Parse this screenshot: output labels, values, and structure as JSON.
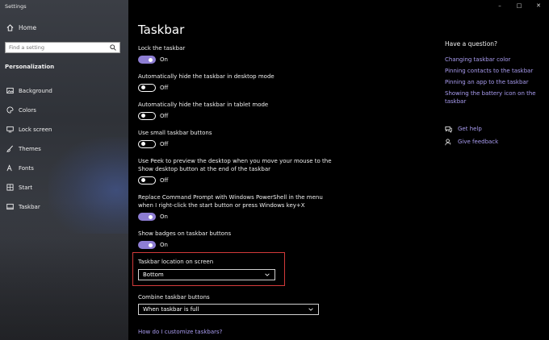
{
  "window": {
    "title": "Settings",
    "controls": [
      "–",
      "□",
      "✕"
    ]
  },
  "sidebar": {
    "home_label": "Home",
    "search_placeholder": "Find a setting",
    "section": "Personalization",
    "items": [
      {
        "label": "Background",
        "icon": "picture-icon"
      },
      {
        "label": "Colors",
        "icon": "palette-icon"
      },
      {
        "label": "Lock screen",
        "icon": "monitor-icon"
      },
      {
        "label": "Themes",
        "icon": "brush-icon"
      },
      {
        "label": "Fonts",
        "icon": "font-icon"
      },
      {
        "label": "Start",
        "icon": "start-icon"
      },
      {
        "label": "Taskbar",
        "icon": "taskbar-icon",
        "active": true
      }
    ]
  },
  "main": {
    "title": "Taskbar",
    "settings": [
      {
        "label": "Lock the taskbar",
        "state": "On"
      },
      {
        "label": "Automatically hide the taskbar in desktop mode",
        "state": "Off"
      },
      {
        "label": "Automatically hide the taskbar in tablet mode",
        "state": "Off"
      },
      {
        "label": "Use small taskbar buttons",
        "state": "Off"
      },
      {
        "label": "Use Peek to preview the desktop when you move your mouse to the Show desktop button at the end of the taskbar",
        "state": "Off"
      },
      {
        "label": "Replace Command Prompt with Windows PowerShell in the menu when I right-click the start button or press Windows key+X",
        "state": "On"
      },
      {
        "label": "Show badges on taskbar buttons",
        "state": "On"
      }
    ],
    "location": {
      "label": "Taskbar location on screen",
      "value": "Bottom"
    },
    "combine": {
      "label": "Combine taskbar buttons",
      "value": "When taskbar is full"
    },
    "customize_link": "How do I customize taskbars?"
  },
  "help": {
    "heading": "Have a question?",
    "links": [
      "Changing taskbar color",
      "Pinning contacts to the taskbar",
      "Pinning an app to the taskbar",
      "Showing the battery icon on the taskbar"
    ],
    "get_help": "Get help",
    "give_feedback": "Give feedback"
  },
  "colors": {
    "accent": "#8d7dd3",
    "link": "#a99cf0",
    "highlight": "#d23a3a"
  }
}
